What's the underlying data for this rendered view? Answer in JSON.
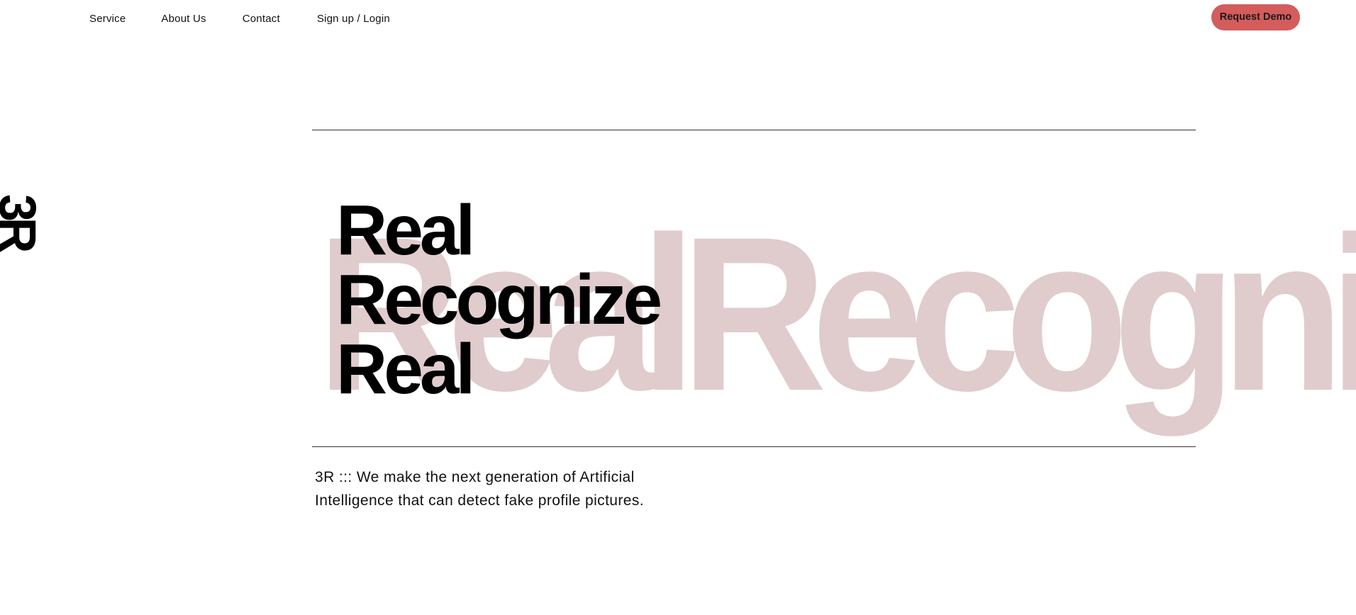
{
  "nav": {
    "items": [
      {
        "label": "Service"
      },
      {
        "label": "About Us"
      },
      {
        "label": "Contact"
      },
      {
        "label": "Sign up / Login"
      }
    ],
    "cta_label": "Request Demo"
  },
  "side_logo": "3R",
  "hero": {
    "lines": [
      "Real",
      "Recognize",
      "Real"
    ],
    "background_text": "RealRecognizeReal"
  },
  "tagline": {
    "line1": "3R ::: We make the next generation of Artificial",
    "line2": "Intelligence that can detect fake profile pictures."
  },
  "colors": {
    "cta_background": "#d45c5c",
    "background_text": "#e0cccc",
    "foreground_text": "#000000"
  }
}
